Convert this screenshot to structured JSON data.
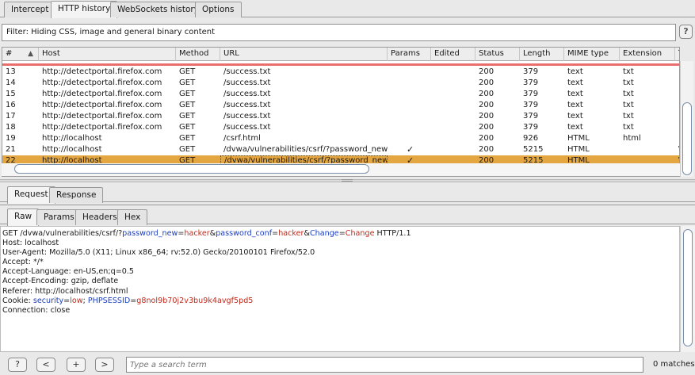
{
  "top_tabs": [
    "Intercept",
    "HTTP history",
    "WebSockets history",
    "Options"
  ],
  "filter": {
    "text": "Filter: Hiding CSS, image and general binary content",
    "help_label": "?"
  },
  "table": {
    "headers": [
      "#",
      "Host",
      "Method",
      "URL",
      "Params",
      "Edited",
      "Status",
      "Length",
      "MIME type",
      "Extension",
      "T"
    ],
    "sort_indicator": "▲",
    "rows": [
      {
        "num": "13",
        "host": "http://detectportal.firefox.com",
        "method": "GET",
        "url": "/success.txt",
        "params": "",
        "edited": "",
        "status": "200",
        "length": "379",
        "mime": "text",
        "ext": "txt",
        "extra": ""
      },
      {
        "num": "14",
        "host": "http://detectportal.firefox.com",
        "method": "GET",
        "url": "/success.txt",
        "params": "",
        "edited": "",
        "status": "200",
        "length": "379",
        "mime": "text",
        "ext": "txt",
        "extra": ""
      },
      {
        "num": "15",
        "host": "http://detectportal.firefox.com",
        "method": "GET",
        "url": "/success.txt",
        "params": "",
        "edited": "",
        "status": "200",
        "length": "379",
        "mime": "text",
        "ext": "txt",
        "extra": ""
      },
      {
        "num": "16",
        "host": "http://detectportal.firefox.com",
        "method": "GET",
        "url": "/success.txt",
        "params": "",
        "edited": "",
        "status": "200",
        "length": "379",
        "mime": "text",
        "ext": "txt",
        "extra": ""
      },
      {
        "num": "17",
        "host": "http://detectportal.firefox.com",
        "method": "GET",
        "url": "/success.txt",
        "params": "",
        "edited": "",
        "status": "200",
        "length": "379",
        "mime": "text",
        "ext": "txt",
        "extra": ""
      },
      {
        "num": "18",
        "host": "http://detectportal.firefox.com",
        "method": "GET",
        "url": "/success.txt",
        "params": "",
        "edited": "",
        "status": "200",
        "length": "379",
        "mime": "text",
        "ext": "txt",
        "extra": ""
      },
      {
        "num": "19",
        "host": "http://localhost",
        "method": "GET",
        "url": "/csrf.html",
        "params": "",
        "edited": "",
        "status": "200",
        "length": "926",
        "mime": "HTML",
        "ext": "html",
        "extra": ""
      },
      {
        "num": "21",
        "host": "http://localhost",
        "method": "GET",
        "url": "/dvwa/vulnerabilities/csrf/?password_new...",
        "params": "✓",
        "edited": "",
        "status": "200",
        "length": "5215",
        "mime": "HTML",
        "ext": "",
        "extra": "\\"
      },
      {
        "num": "22",
        "host": "http://localhost",
        "method": "GET",
        "url": "/dvwa/vulnerabilities/csrf/?password_new...",
        "params": "✓",
        "edited": "",
        "status": "200",
        "length": "5215",
        "mime": "HTML",
        "ext": "",
        "extra": "\\"
      }
    ],
    "selected_index": 8
  },
  "panel_tabs": [
    "Request",
    "Response"
  ],
  "view_tabs": [
    "Raw",
    "Params",
    "Headers",
    "Hex"
  ],
  "request": {
    "line1": {
      "pre": "GET /dvwa/vulnerabilities/csrf/?",
      "k1": "password_new",
      "eq1": "=",
      "v1": "hacker",
      "amp1": "&",
      "k2": "password_conf",
      "eq2": "=",
      "v2": "hacker",
      "amp2": "&",
      "k3": "Change",
      "eq3": "=",
      "v3": "Change",
      "post": " HTTP/1.1"
    },
    "headers": [
      "Host: localhost",
      "User-Agent: Mozilla/5.0 (X11; Linux x86_64; rv:52.0) Gecko/20100101 Firefox/52.0",
      "Accept: */*",
      "Accept-Language: en-US,en;q=0.5",
      "Accept-Encoding: gzip, deflate",
      "Referer: http://localhost/csrf.html"
    ],
    "cookie": {
      "pre": "Cookie: ",
      "k1": "security",
      "eq1": "=",
      "v1": "low",
      "sep": "; ",
      "k2": "PHPSESSID",
      "eq2": "=",
      "v2": "g8nol9b70j2v3bu9k4avgf5pd5"
    },
    "last": "Connection: close"
  },
  "bottom": {
    "help": "?",
    "prev": "<",
    "add": "+",
    "next": ">",
    "search_placeholder": "Type a search term",
    "matches": "0 matches"
  },
  "colors": {
    "selected_row": "#e4a640",
    "param_key": "#1a3dc0",
    "param_value": "#c0281a",
    "highlight_line": "#e96e6e"
  }
}
